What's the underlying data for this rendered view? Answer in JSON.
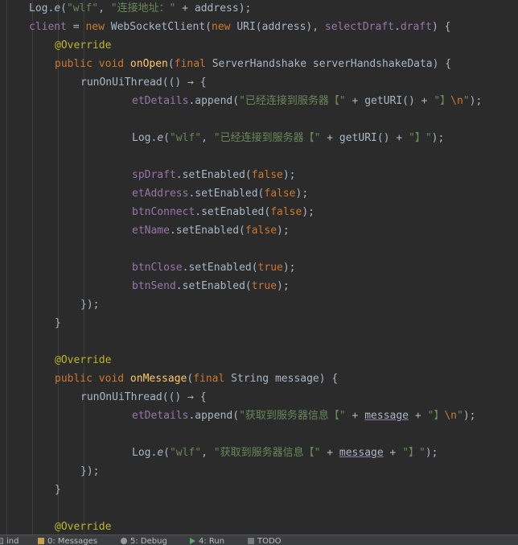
{
  "editor": {
    "lines": [
      [
        [
          "default",
          "Log."
        ],
        [
          "method-italic",
          "e"
        ],
        [
          "default",
          "("
        ],
        [
          "string",
          "\"wlf\""
        ],
        [
          "default",
          ", "
        ],
        [
          "string",
          "\"连接地址：\""
        ],
        [
          "default",
          " + address);"
        ]
      ],
      [
        [
          "field",
          "client"
        ],
        [
          "default",
          " = "
        ],
        [
          "keyword",
          "new "
        ],
        [
          "default",
          "WebSocketClient("
        ],
        [
          "keyword",
          "new "
        ],
        [
          "default",
          "URI(address), "
        ],
        [
          "field",
          "selectDraft"
        ],
        [
          "default",
          "."
        ],
        [
          "field",
          "draft"
        ],
        [
          "default",
          ") {"
        ]
      ],
      [
        [
          "annotation",
          "@Override"
        ]
      ],
      [
        [
          "keyword",
          "public void "
        ],
        [
          "method",
          "onOpen"
        ],
        [
          "default",
          "("
        ],
        [
          "keyword",
          "final "
        ],
        [
          "default",
          "ServerHandshake serverHandshakeData) {"
        ]
      ],
      [
        [
          "default",
          "runOnUiThread("
        ],
        [
          "lambda",
          "() → {"
        ]
      ],
      [
        [
          "field",
          "etDetails"
        ],
        [
          "default",
          ".append("
        ],
        [
          "string",
          "\"已经连接到服务器【\""
        ],
        [
          "default",
          " + getURI() + "
        ],
        [
          "string",
          "\"】"
        ],
        [
          "escape",
          "\\n"
        ],
        [
          "string",
          "\""
        ],
        [
          "default",
          ");"
        ]
      ],
      [],
      [
        [
          "default",
          "Log."
        ],
        [
          "method-italic",
          "e"
        ],
        [
          "default",
          "("
        ],
        [
          "string",
          "\"wlf\""
        ],
        [
          "default",
          ", "
        ],
        [
          "string",
          "\"已经连接到服务器【\""
        ],
        [
          "default",
          " + getURI() + "
        ],
        [
          "string",
          "\"】\""
        ],
        [
          "default",
          ");"
        ]
      ],
      [],
      [
        [
          "field",
          "spDraft"
        ],
        [
          "default",
          ".setEnabled("
        ],
        [
          "keyword",
          "false"
        ],
        [
          "default",
          ");"
        ]
      ],
      [
        [
          "field",
          "etAddress"
        ],
        [
          "default",
          ".setEnabled("
        ],
        [
          "keyword",
          "false"
        ],
        [
          "default",
          ");"
        ]
      ],
      [
        [
          "field",
          "btnConnect"
        ],
        [
          "default",
          ".setEnabled("
        ],
        [
          "keyword",
          "false"
        ],
        [
          "default",
          ");"
        ]
      ],
      [
        [
          "field",
          "etName"
        ],
        [
          "default",
          ".setEnabled("
        ],
        [
          "keyword",
          "false"
        ],
        [
          "default",
          ");"
        ]
      ],
      [],
      [
        [
          "field",
          "btnClose"
        ],
        [
          "default",
          ".setEnabled("
        ],
        [
          "keyword",
          "true"
        ],
        [
          "default",
          ");"
        ]
      ],
      [
        [
          "field",
          "btnSend"
        ],
        [
          "default",
          ".setEnabled("
        ],
        [
          "keyword",
          "true"
        ],
        [
          "default",
          ");"
        ]
      ],
      [
        [
          "default",
          "});"
        ]
      ],
      [
        [
          "default",
          "}"
        ]
      ],
      [],
      [
        [
          "annotation",
          "@Override"
        ]
      ],
      [
        [
          "keyword",
          "public void "
        ],
        [
          "method",
          "onMessage"
        ],
        [
          "default",
          "("
        ],
        [
          "keyword",
          "final "
        ],
        [
          "default",
          "String message) {"
        ]
      ],
      [
        [
          "default",
          "runOnUiThread("
        ],
        [
          "lambda",
          "() → {"
        ]
      ],
      [
        [
          "field",
          "etDetails"
        ],
        [
          "default",
          ".append("
        ],
        [
          "string",
          "\"获取到服务器信息【\""
        ],
        [
          "default",
          " + "
        ],
        [
          "underline",
          "message"
        ],
        [
          "default",
          " + "
        ],
        [
          "string",
          "\"】"
        ],
        [
          "escape",
          "\\n"
        ],
        [
          "string",
          "\""
        ],
        [
          "default",
          ");"
        ]
      ],
      [],
      [
        [
          "default",
          "Log."
        ],
        [
          "method-italic",
          "e"
        ],
        [
          "default",
          "("
        ],
        [
          "string",
          "\"wlf\""
        ],
        [
          "default",
          ", "
        ],
        [
          "string",
          "\"获取到服务器信息【\""
        ],
        [
          "default",
          " + "
        ],
        [
          "underline",
          "message"
        ],
        [
          "default",
          " + "
        ],
        [
          "string",
          "\"】\""
        ],
        [
          "default",
          ");"
        ]
      ],
      [
        [
          "default",
          "});"
        ]
      ],
      [
        [
          "default",
          "}"
        ]
      ],
      [],
      [
        [
          "annotation",
          "@Override"
        ]
      ]
    ]
  },
  "colors": {
    "background": "#2b2b2b",
    "default": "#a9b7c6",
    "keyword": "#cc7832",
    "string": "#6a8759",
    "field": "#9876aa",
    "annotation": "#bbb529",
    "method": "#ffc66d"
  },
  "toolbar": {
    "items": [
      {
        "icon": "terminal-icon",
        "label": "ind"
      },
      {
        "icon": "messages-icon",
        "label": "0: Messages"
      },
      {
        "icon": "debug-icon",
        "label": "5: Debug"
      },
      {
        "icon": "run-icon",
        "label": "4: Run"
      },
      {
        "icon": "todo-icon",
        "label": "TODO"
      }
    ]
  }
}
